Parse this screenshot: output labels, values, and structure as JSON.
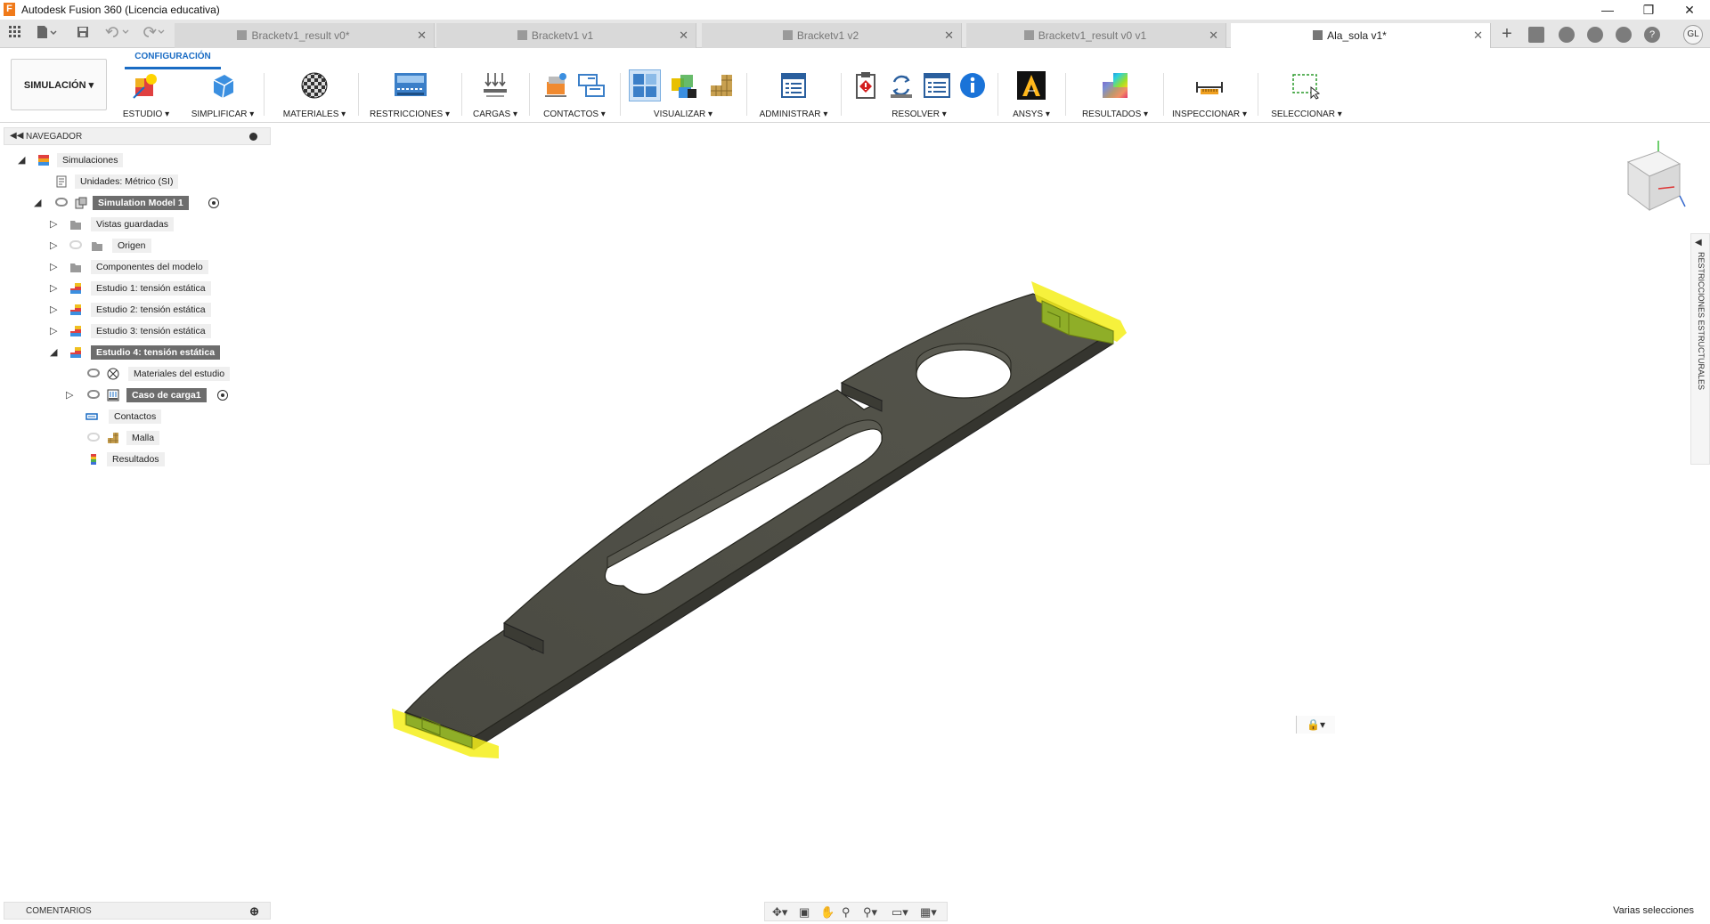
{
  "window": {
    "title": "Autodesk Fusion 360 (Licencia educativa)",
    "logo_letter": "F",
    "controls": {
      "minimize": "—",
      "restore": "❐",
      "close": "✕"
    }
  },
  "tabs": [
    {
      "label": "Bracketv1_result v0*",
      "active": false
    },
    {
      "label": "Bracketv1 v1",
      "active": false
    },
    {
      "label": "Bracketv1 v2",
      "active": false
    },
    {
      "label": "Bracketv1_result v0 v1",
      "active": false
    },
    {
      "label": "Ala_sola v1*",
      "active": true
    }
  ],
  "tabbar": {
    "new_tab": "+",
    "user_initials": "GL"
  },
  "ribbon": {
    "workspace": "SIMULACIÓN",
    "active_tab": "CONFIGURACIÓN",
    "groups": [
      "ESTUDIO",
      "SIMPLIFICAR",
      "MATERIALES",
      "RESTRICCIONES",
      "CARGAS",
      "CONTACTOS",
      "VISUALIZAR",
      "ADMINISTRAR",
      "RESOLVER",
      "ANSYS",
      "RESULTADOS",
      "INSPECCIONAR",
      "SELECCIONAR"
    ],
    "dropdown_glyph": "▾"
  },
  "navigator": {
    "title": "NAVEGADOR",
    "items": {
      "root": "Simulaciones",
      "units": "Unidades: Métrico (SI)",
      "model": "Simulation Model 1",
      "saved_views": "Vistas guardadas",
      "origin": "Origen",
      "components": "Componentes del modelo",
      "study1": "Estudio 1: tensión estática",
      "study2": "Estudio 2: tensión estática",
      "study3": "Estudio 3: tensión estática",
      "study4": "Estudio 4: tensión estática",
      "materials": "Materiales del estudio",
      "loadcase": "Caso de carga1",
      "contacts": "Contactos",
      "mesh": "Malla",
      "results": "Resultados"
    }
  },
  "right_panel": {
    "label": "RESTRICCIONES ESTRUCTURALES"
  },
  "comments": {
    "title": "COMENTARIOS"
  },
  "status": {
    "text": "Varias selecciones"
  },
  "colors": {
    "accent": "#1a6cc4",
    "part_fill": "#4a4a42",
    "part_edge": "#2a2a24",
    "highlight": "#f5ef1a"
  }
}
